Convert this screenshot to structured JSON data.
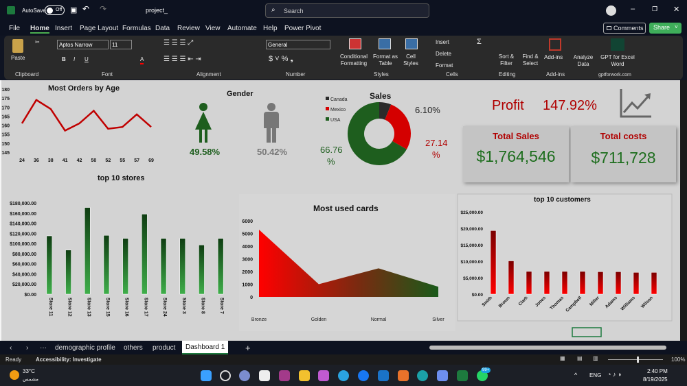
{
  "titlebar": {
    "autosave": "AutoSave",
    "toggle": "Off",
    "filename": "project_",
    "search_placeholder": "Search"
  },
  "menu": [
    "File",
    "Home",
    "Insert",
    "Page Layout",
    "Formulas",
    "Data",
    "Review",
    "View",
    "Automate",
    "Help",
    "Power Pivot"
  ],
  "actions": {
    "comments": "Comments",
    "share": "Share"
  },
  "ribbon": {
    "paste": "Paste",
    "font_name": "Aptos Narrow",
    "font_size": "11",
    "number_format": "General",
    "conditional": "Conditional Formatting",
    "format_table": "Format as Table",
    "cell_styles": "Cell Styles",
    "insert": "Insert",
    "delete": "Delete",
    "format": "Format",
    "sort": "Sort & Filter",
    "find": "Find & Select",
    "addins": "Add-ins",
    "analyze": "Analyze Data",
    "gpt": "GPT for Excel Word",
    "groups": [
      "Clipboard",
      "Font",
      "Alignment",
      "Number",
      "Styles",
      "Cells",
      "Editing",
      "Add-ins",
      "gptforwork.com"
    ]
  },
  "dashboard": {
    "gender_title": "Gender",
    "female_pct": "49.58%",
    "male_pct": "50.42%",
    "profit_label": "Profit",
    "profit_value": "147.92%",
    "total_sales_label": "Total Sales",
    "total_sales_value": "$1,764,546",
    "total_costs_label": "Total costs",
    "total_costs_value": "$711,728"
  },
  "chart_data": [
    {
      "id": "age",
      "type": "line",
      "title": "Most Orders by Age",
      "categories": [
        "24",
        "36",
        "38",
        "41",
        "42",
        "50",
        "52",
        "55",
        "57",
        "69"
      ],
      "values": [
        161,
        174,
        169,
        157,
        161,
        168,
        158,
        159,
        166,
        159
      ],
      "ylim": [
        145,
        180
      ],
      "yticks": [
        "180",
        "175",
        "170",
        "165",
        "160",
        "155",
        "150",
        "145"
      ],
      "color": "#c00000"
    },
    {
      "id": "sales",
      "type": "pie",
      "title": "Sales",
      "labels": [
        "Canada",
        "Mexico",
        "USA"
      ],
      "values": [
        6.1,
        27.14,
        66.76
      ],
      "value_labels": [
        "6.10%",
        "27.14 %",
        "66.76 %"
      ],
      "colors": [
        "#2b2b2b",
        "#d40000",
        "#1e5e1e"
      ]
    },
    {
      "id": "stores",
      "type": "bar",
      "title": "top 10 stores",
      "categories": [
        "Store 11",
        "Store 12",
        "Store 13",
        "Store 15",
        "Store 16",
        "Store 17",
        "Store 24",
        "Store 3",
        "Store 8",
        "Store 7"
      ],
      "values": [
        115000,
        87000,
        171000,
        116000,
        110000,
        158000,
        110000,
        110000,
        97000,
        110000
      ],
      "ylim": [
        0,
        180000
      ],
      "yticks": [
        "$180,000.00",
        "$160,000.00",
        "$140,000.00",
        "$120,000.00",
        "$100,000.00",
        "$80,000.00",
        "$60,000.00",
        "$40,000.00",
        "$20,000.00",
        "$0.00"
      ]
    },
    {
      "id": "cards",
      "type": "area",
      "title": "Most used cards",
      "categories": [
        "Bronze",
        "Golden",
        "Normal",
        "Silver"
      ],
      "values": [
        5300,
        1000,
        2250,
        800
      ],
      "ylim": [
        0,
        6000
      ],
      "yticks": [
        "6000",
        "5000",
        "4000",
        "3000",
        "2000",
        "1000",
        "0"
      ]
    },
    {
      "id": "customers",
      "type": "bar",
      "title": "top 10 customers",
      "categories": [
        "Smith",
        "Brown",
        "Clark",
        "Jones",
        "Thomas",
        "Campbell",
        "Miller",
        "Adams",
        "Williams",
        "Wilson"
      ],
      "values": [
        19300,
        10100,
        6900,
        6900,
        6900,
        6900,
        6800,
        6800,
        6600,
        6600
      ],
      "ylim": [
        0,
        25000
      ],
      "yticks": [
        "$25,000.00",
        "$20,000.00",
        "$15,000.00",
        "$10,000.00",
        "$5,000.00",
        "$0.00"
      ]
    }
  ],
  "sheets": [
    "demographic profile",
    "others",
    "product",
    "Dashboard 1"
  ],
  "status": {
    "ready": "Ready",
    "accessibility": "Accessibility: Investigate",
    "zoom": "100%"
  },
  "taskbar": {
    "temp": "33°C",
    "weather": "مشمس",
    "lang": "ENG",
    "time": "2:40 PM",
    "date": "8/19/2025",
    "badge": "99+"
  }
}
